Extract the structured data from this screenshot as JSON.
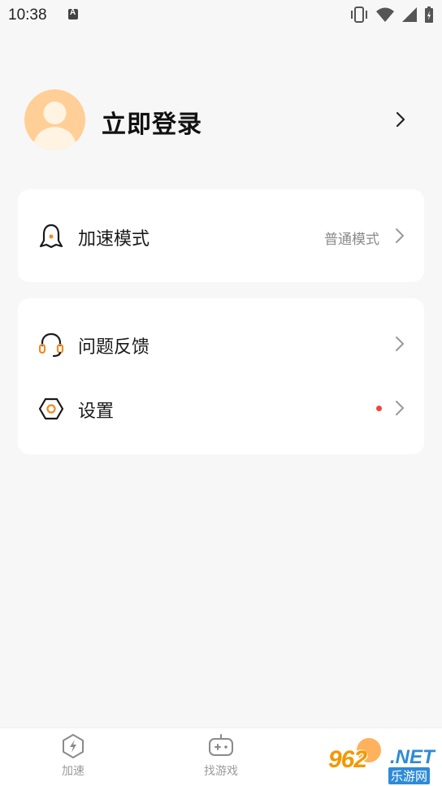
{
  "status_bar": {
    "time": "10:38"
  },
  "profile": {
    "login_label": "立即登录"
  },
  "mode_card": {
    "label": "加速模式",
    "value": "普通模式"
  },
  "help_card": {
    "feedback_label": "问题反馈",
    "settings_label": "设置"
  },
  "tabbar": {
    "tabs": [
      {
        "label": "加速"
      },
      {
        "label": "找游戏"
      }
    ]
  },
  "watermark": {
    "number": "962",
    "net": ".NET",
    "subtitle": "乐游网"
  },
  "colors": {
    "accent": "#ffcf97",
    "icon_orange": "#f08a24",
    "badge_red": "#f0463c"
  }
}
